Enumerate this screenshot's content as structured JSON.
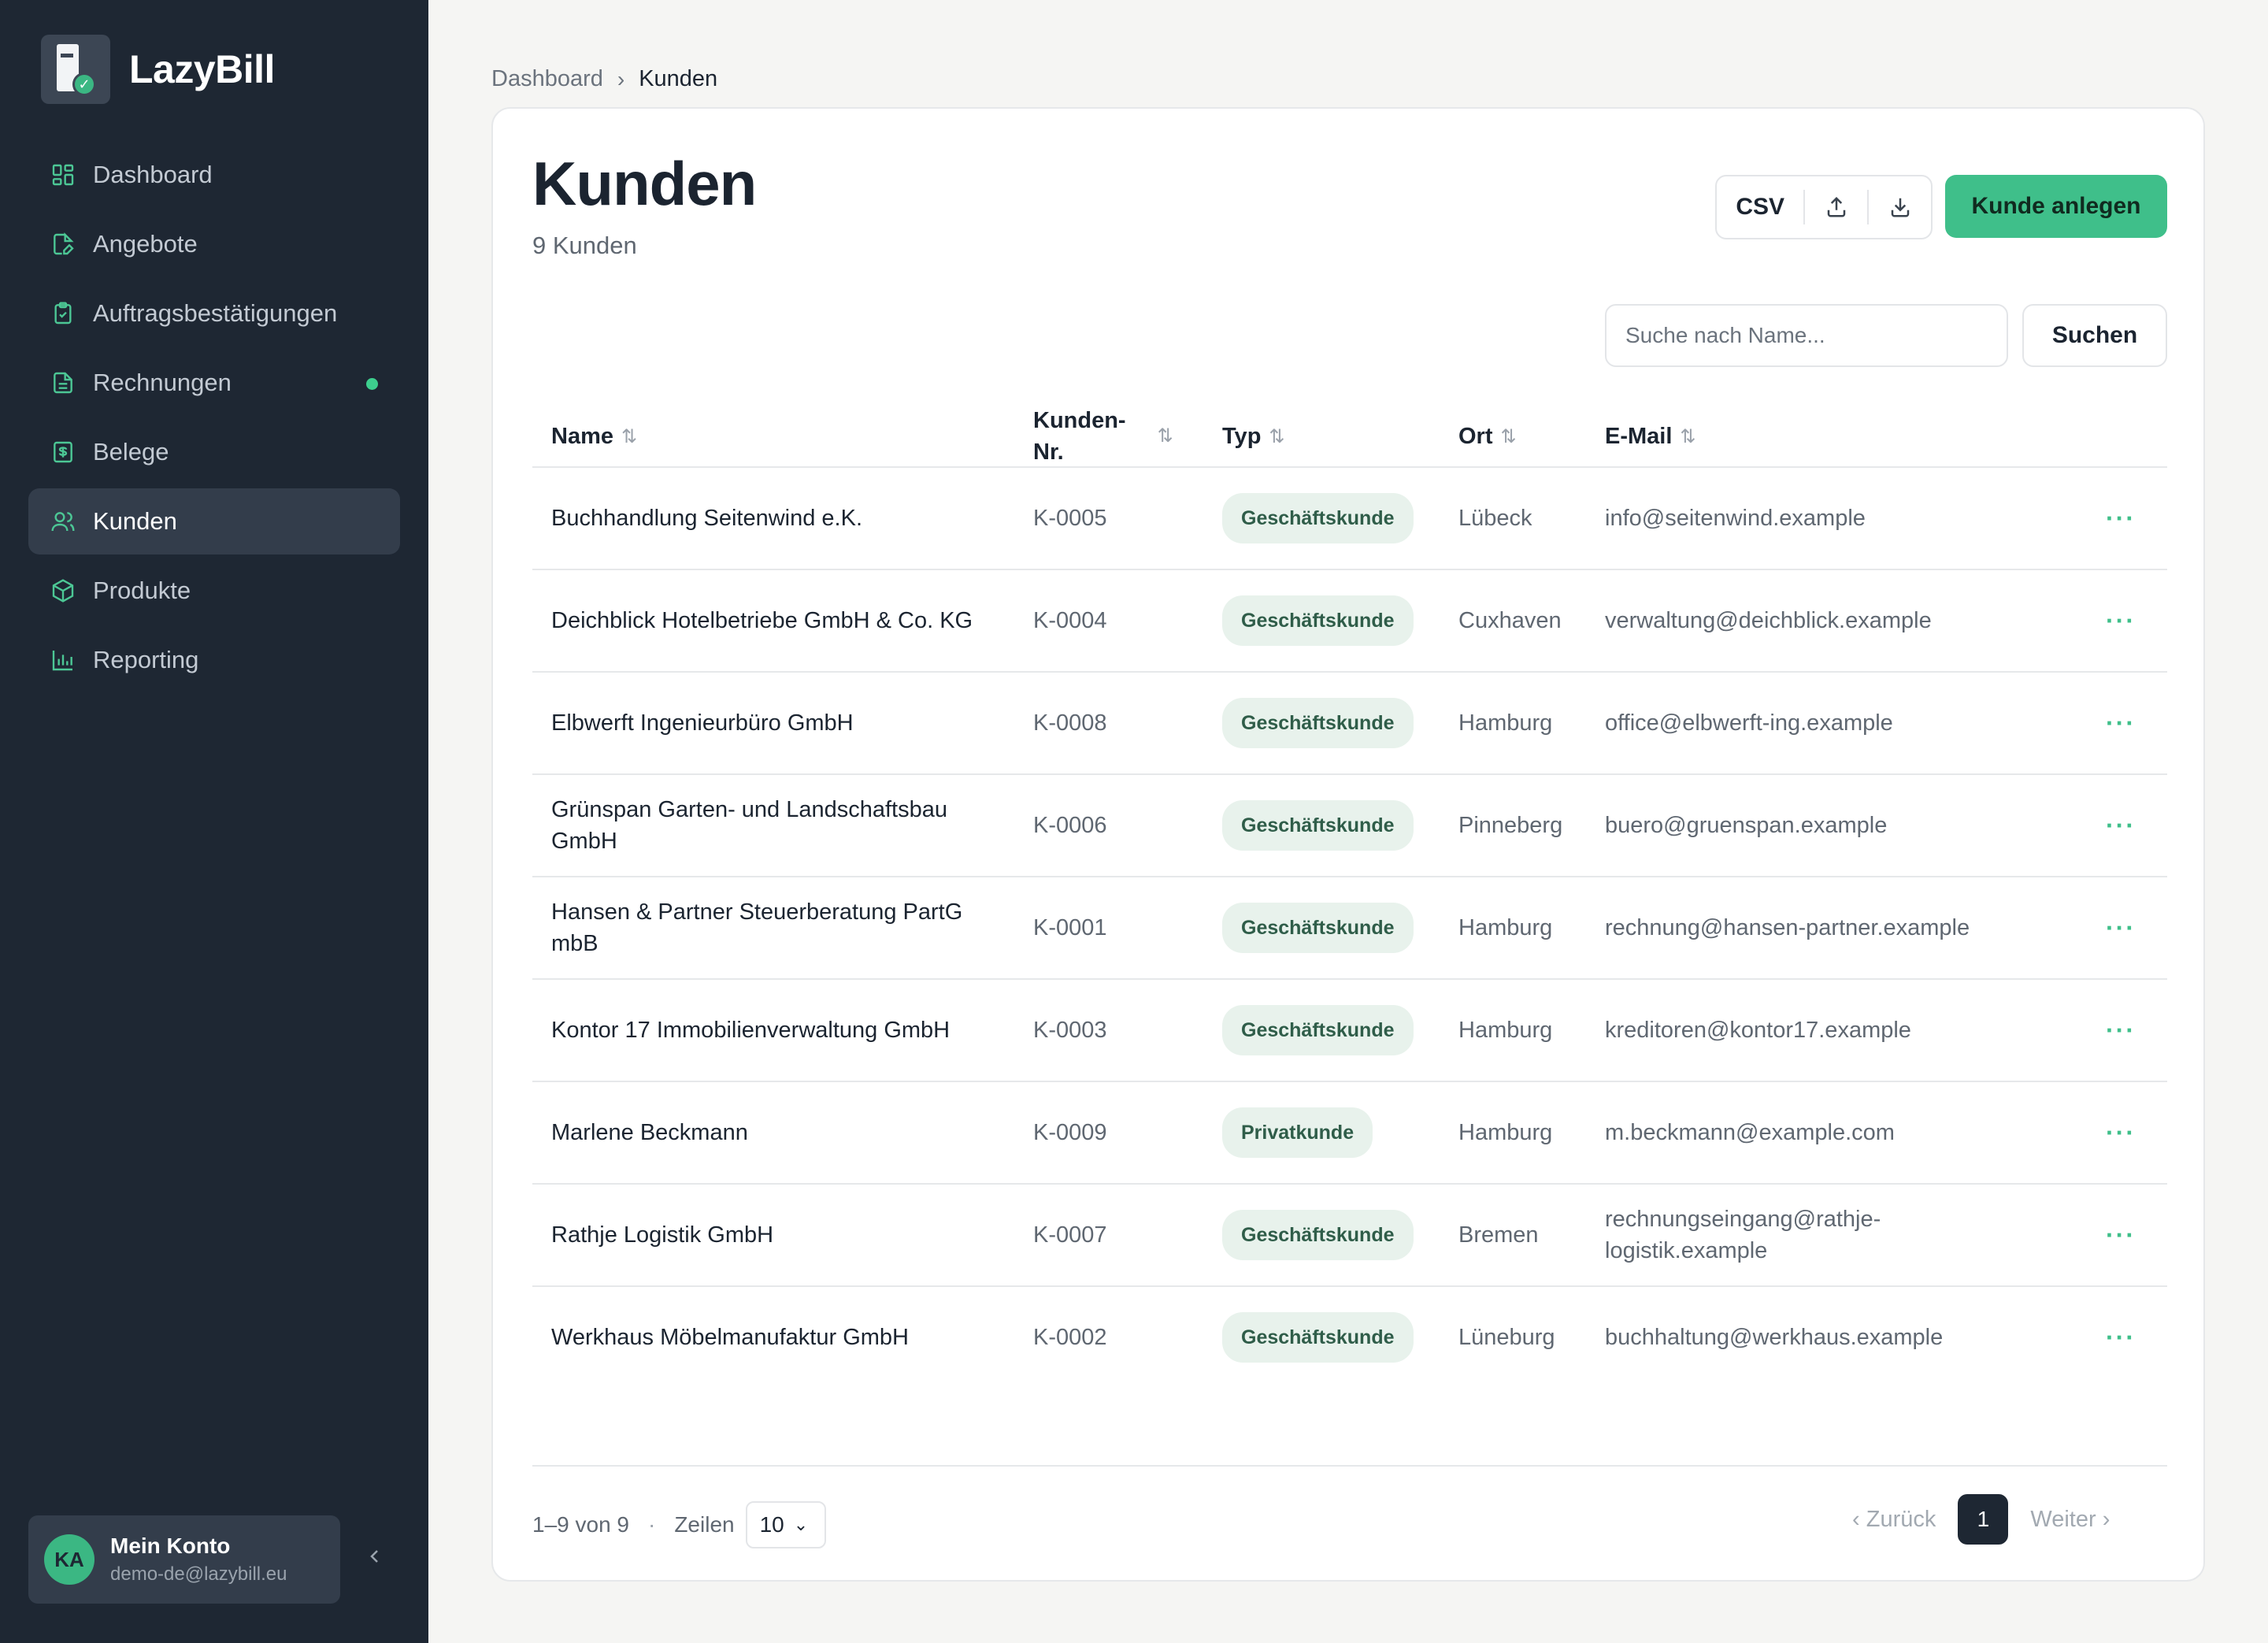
{
  "app": {
    "name": "LazyBill"
  },
  "sidebar": {
    "items": [
      {
        "label": "Dashboard",
        "icon": "dashboard-icon"
      },
      {
        "label": "Angebote",
        "icon": "file-edit-icon"
      },
      {
        "label": "Auftragsbestätigungen",
        "icon": "clipboard-check-icon"
      },
      {
        "label": "Rechnungen",
        "icon": "invoice-icon",
        "dot": true
      },
      {
        "label": "Belege",
        "icon": "receipt-icon"
      },
      {
        "label": "Kunden",
        "icon": "users-icon",
        "active": true
      },
      {
        "label": "Produkte",
        "icon": "box-icon"
      },
      {
        "label": "Reporting",
        "icon": "bar-chart-icon"
      }
    ],
    "account": {
      "initials": "KA",
      "name": "Mein Konto",
      "email": "demo-de@lazybill.eu"
    }
  },
  "breadcrumb": {
    "parent": "Dashboard",
    "current": "Kunden"
  },
  "page": {
    "title": "Kunden",
    "subtitle": "9 Kunden"
  },
  "toolbar": {
    "csv_label": "CSV",
    "create_label": "Kunde anlegen"
  },
  "search": {
    "placeholder": "Suche nach Name...",
    "button_label": "Suchen"
  },
  "table": {
    "columns": {
      "name": "Name",
      "number_line1": "Kunden-",
      "number_line2": "Nr.",
      "type": "Typ",
      "city": "Ort",
      "email": "E-Mail"
    },
    "rows": [
      {
        "name": "Buchhandlung Seitenwind e.K.",
        "number": "K-0005",
        "type": "Geschäftskunde",
        "city": "Lübeck",
        "email": "info@seitenwind.example"
      },
      {
        "name": "Deichblick Hotelbetriebe GmbH & Co. KG",
        "number": "K-0004",
        "type": "Geschäftskunde",
        "city": "Cuxhaven",
        "email": "verwaltung@deichblick.example"
      },
      {
        "name": "Elbwerft Ingenieurbüro GmbH",
        "number": "K-0008",
        "type": "Geschäftskunde",
        "city": "Hamburg",
        "email": "office@elbwerft-ing.example"
      },
      {
        "name": "Grünspan Garten- und Landschaftsbau GmbH",
        "number": "K-0006",
        "type": "Geschäftskunde",
        "city": "Pinneberg",
        "email": "buero@gruenspan.example"
      },
      {
        "name": "Hansen & Partner Steuerberatung PartG mbB",
        "number": "K-0001",
        "type": "Geschäftskunde",
        "city": "Hamburg",
        "email": "rechnung@hansen-partner.example"
      },
      {
        "name": "Kontor 17 Immobilienverwaltung GmbH",
        "number": "K-0003",
        "type": "Geschäftskunde",
        "city": "Hamburg",
        "email": "kreditoren@kontor17.example"
      },
      {
        "name": "Marlene Beckmann",
        "number": "K-0009",
        "type": "Privatkunde",
        "city": "Hamburg",
        "email": "m.beckmann@example.com"
      },
      {
        "name": "Rathje Logistik GmbH",
        "number": "K-0007",
        "type": "Geschäftskunde",
        "city": "Bremen",
        "email": "rechnungseingang@rathje-logistik.example"
      },
      {
        "name": "Werkhaus Möbelmanufaktur GmbH",
        "number": "K-0002",
        "type": "Geschäftskunde",
        "city": "Lüneburg",
        "email": "buchhaltung@werkhaus.example"
      }
    ]
  },
  "pagination": {
    "range": "1–9 von 9",
    "rows_label": "Zeilen",
    "rows_value": "10",
    "prev_label": "Zurück",
    "next_label": "Weiter",
    "current_page": "1"
  },
  "colors": {
    "sidebar_bg": "#1e2733",
    "accent": "#3fbf8a",
    "badge_bg": "#e8f2ec"
  }
}
